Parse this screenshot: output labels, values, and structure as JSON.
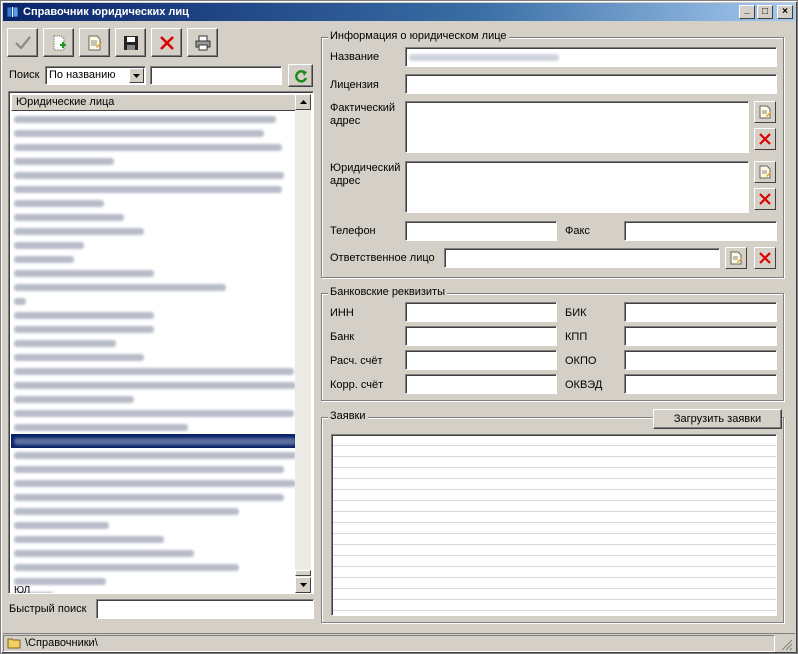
{
  "window": {
    "title": "Справочник юридических лиц",
    "controls": {
      "minimize": "_",
      "maximize": "□",
      "close": "×"
    }
  },
  "toolbar": {
    "buttons": [
      {
        "name": "apply",
        "icon": "checkmark-icon"
      },
      {
        "name": "add",
        "icon": "new-document-icon"
      },
      {
        "name": "edit",
        "icon": "edit-document-icon"
      },
      {
        "name": "save",
        "icon": "floppy-disk-icon"
      },
      {
        "name": "delete",
        "icon": "red-x-icon"
      },
      {
        "name": "print",
        "icon": "printer-icon"
      }
    ]
  },
  "search": {
    "label": "Поиск",
    "mode": "По названию",
    "value": "",
    "refresh_icon": "green-refresh-icon"
  },
  "list": {
    "header": "Юридические лица",
    "row_count_visible": 35,
    "selected_index": 23,
    "partial_last": "ЮЛ"
  },
  "quick_search": {
    "label": "Быстрый поиск",
    "value": ""
  },
  "info": {
    "title": "Информация о юридическом лице",
    "name_label": "Название",
    "license_label": "Лицензия",
    "actual_address_label": "Фактический адрес",
    "legal_address_label": "Юридический адрес",
    "phone_label": "Телефон",
    "fax_label": "Факс",
    "responsible_label": "Ответственное лицо"
  },
  "bank": {
    "title": "Банковские реквизиты",
    "inn_label": "ИНН",
    "bank_label": "Банк",
    "account_label": "Расч. счёт",
    "corr_label": "Корр. счёт",
    "bik_label": "БИК",
    "kpp_label": "КПП",
    "okpo_label": "ОКПО",
    "okved_label": "ОКВЭД"
  },
  "requests": {
    "title": "Заявки",
    "load_button": "Загрузить заявки"
  },
  "status": {
    "path": "\\Справочники\\"
  },
  "colors": {
    "selection": "#0a246a",
    "face": "#d4d0c8",
    "delete_red": "#cc0000"
  }
}
